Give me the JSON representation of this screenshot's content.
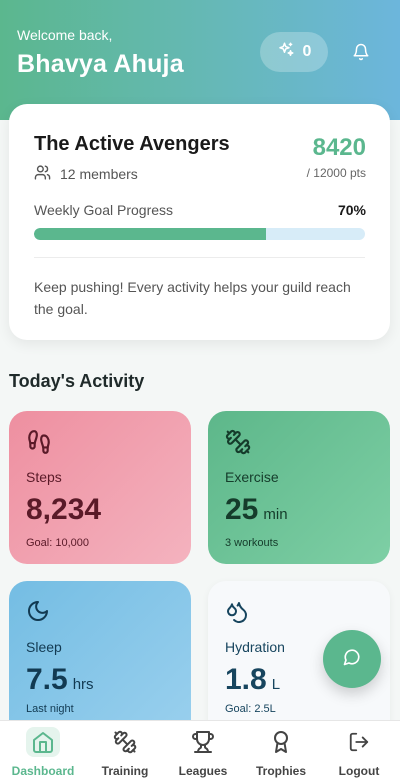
{
  "header": {
    "welcome": "Welcome back,",
    "username": "Bhavya Ahuja",
    "points_value": "0",
    "points_icon": "sparkles-icon",
    "notification_icon": "bell-icon"
  },
  "guild": {
    "name": "The Active Avengers",
    "members": "12 members",
    "score": "8420",
    "target": "/ 12000 pts",
    "goal_label": "Weekly Goal Progress",
    "goal_percent_text": "70%",
    "goal_progress": 0.7,
    "message": "Keep pushing! Every activity helps your guild reach the goal."
  },
  "activity": {
    "title": "Today's Activity",
    "steps": {
      "label": "Steps",
      "value": "8,234",
      "sub": "Goal: 10,000",
      "icon": "footprints-icon"
    },
    "exercise": {
      "label": "Exercise",
      "value": "25",
      "unit": "min",
      "sub": "3 workouts",
      "icon": "dumbbell-icon"
    },
    "sleep": {
      "label": "Sleep",
      "value": "7.5",
      "unit": "hrs",
      "sub": "Last night",
      "icon": "moon-icon"
    },
    "hydration": {
      "label": "Hydration",
      "value": "1.8",
      "unit": "L",
      "sub": "Goal: 2.5L",
      "icon": "droplets-icon"
    }
  },
  "nav": {
    "items": [
      {
        "label": "Dashboard",
        "icon": "home-icon",
        "active": true
      },
      {
        "label": "Training",
        "icon": "dumbbell-icon"
      },
      {
        "label": "Leagues",
        "icon": "trophy-icon"
      },
      {
        "label": "Trophies",
        "icon": "award-icon"
      },
      {
        "label": "Logout",
        "icon": "logout-icon"
      }
    ]
  },
  "colors": {
    "accent": "#5bb78e",
    "progress_track": "#d7ecf8",
    "steps_tile": "#ee8fa0",
    "exercise_tile": "#5db78a",
    "sleep_tile": "#74bde3"
  }
}
